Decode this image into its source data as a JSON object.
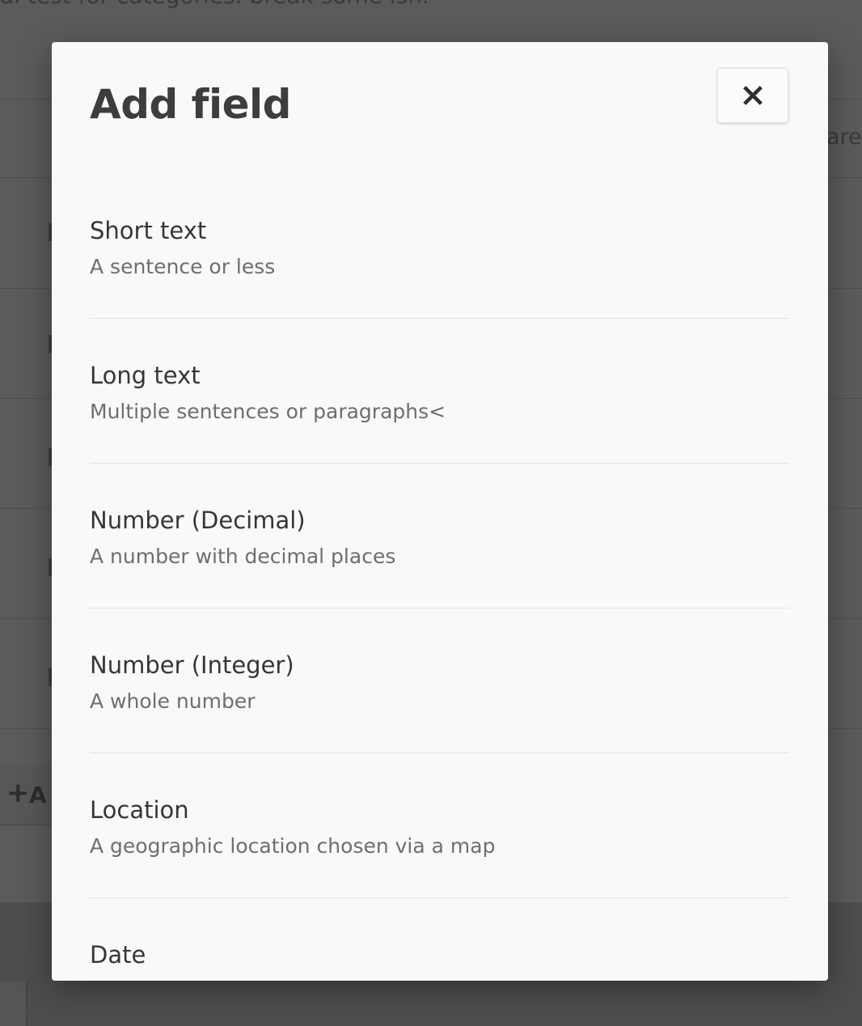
{
  "background": {
    "top_text": "al test for categories. break some ish.",
    "side_text": "are",
    "add_button_label": "A"
  },
  "modal": {
    "title": "Add field",
    "close_label": "Close",
    "options": [
      {
        "name": "Short text",
        "description": "A sentence or less"
      },
      {
        "name": "Long text",
        "description": "Multiple sentences or paragraphs<"
      },
      {
        "name": "Number (Decimal)",
        "description": "A number with decimal places"
      },
      {
        "name": "Number (Integer)",
        "description": "A whole number"
      },
      {
        "name": "Location",
        "description": "A geographic location chosen via a map"
      },
      {
        "name": "Date",
        "description": ""
      }
    ]
  },
  "icons": {
    "close": "close-icon",
    "add": "plus-icon"
  }
}
